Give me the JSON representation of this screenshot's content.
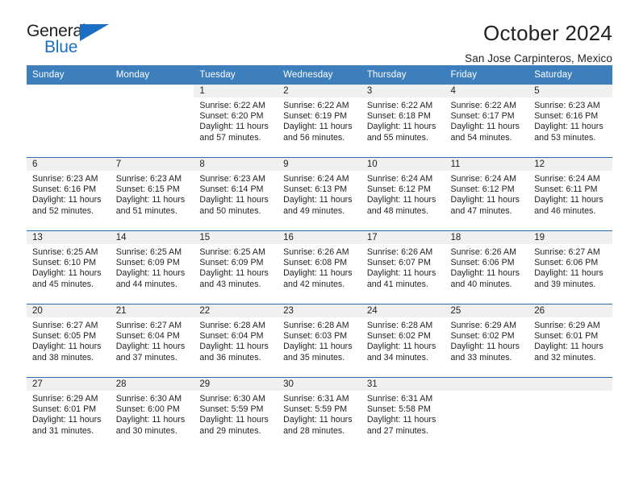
{
  "brand": {
    "name_top": "General",
    "name_bottom": "Blue",
    "triangle_icon": "triangle-icon",
    "color_black": "#231f20",
    "color_blue": "#1a6fc4"
  },
  "header": {
    "title": "October 2024",
    "subtitle": "San Jose Carpinteros, Mexico"
  },
  "theme": {
    "header_row_bg": "#3d7ebd",
    "row_divider": "#2c6bab",
    "daynum_strip_bg": "#f0f0f0",
    "text": "#222222"
  },
  "weekdays": [
    "Sunday",
    "Monday",
    "Tuesday",
    "Wednesday",
    "Thursday",
    "Friday",
    "Saturday"
  ],
  "labels": {
    "sunrise": "Sunrise:",
    "sunset": "Sunset:",
    "daylight": "Daylight:"
  },
  "weeks": [
    [
      {
        "day": "",
        "blank": true
      },
      {
        "day": "",
        "blank": true
      },
      {
        "day": "1",
        "sunrise": "Sunrise: 6:22 AM",
        "sunset": "Sunset: 6:20 PM",
        "daylight": "Daylight: 11 hours and 57 minutes."
      },
      {
        "day": "2",
        "sunrise": "Sunrise: 6:22 AM",
        "sunset": "Sunset: 6:19 PM",
        "daylight": "Daylight: 11 hours and 56 minutes."
      },
      {
        "day": "3",
        "sunrise": "Sunrise: 6:22 AM",
        "sunset": "Sunset: 6:18 PM",
        "daylight": "Daylight: 11 hours and 55 minutes."
      },
      {
        "day": "4",
        "sunrise": "Sunrise: 6:22 AM",
        "sunset": "Sunset: 6:17 PM",
        "daylight": "Daylight: 11 hours and 54 minutes."
      },
      {
        "day": "5",
        "sunrise": "Sunrise: 6:23 AM",
        "sunset": "Sunset: 6:16 PM",
        "daylight": "Daylight: 11 hours and 53 minutes."
      }
    ],
    [
      {
        "day": "6",
        "sunrise": "Sunrise: 6:23 AM",
        "sunset": "Sunset: 6:16 PM",
        "daylight": "Daylight: 11 hours and 52 minutes."
      },
      {
        "day": "7",
        "sunrise": "Sunrise: 6:23 AM",
        "sunset": "Sunset: 6:15 PM",
        "daylight": "Daylight: 11 hours and 51 minutes."
      },
      {
        "day": "8",
        "sunrise": "Sunrise: 6:23 AM",
        "sunset": "Sunset: 6:14 PM",
        "daylight": "Daylight: 11 hours and 50 minutes."
      },
      {
        "day": "9",
        "sunrise": "Sunrise: 6:24 AM",
        "sunset": "Sunset: 6:13 PM",
        "daylight": "Daylight: 11 hours and 49 minutes."
      },
      {
        "day": "10",
        "sunrise": "Sunrise: 6:24 AM",
        "sunset": "Sunset: 6:12 PM",
        "daylight": "Daylight: 11 hours and 48 minutes."
      },
      {
        "day": "11",
        "sunrise": "Sunrise: 6:24 AM",
        "sunset": "Sunset: 6:12 PM",
        "daylight": "Daylight: 11 hours and 47 minutes."
      },
      {
        "day": "12",
        "sunrise": "Sunrise: 6:24 AM",
        "sunset": "Sunset: 6:11 PM",
        "daylight": "Daylight: 11 hours and 46 minutes."
      }
    ],
    [
      {
        "day": "13",
        "sunrise": "Sunrise: 6:25 AM",
        "sunset": "Sunset: 6:10 PM",
        "daylight": "Daylight: 11 hours and 45 minutes."
      },
      {
        "day": "14",
        "sunrise": "Sunrise: 6:25 AM",
        "sunset": "Sunset: 6:09 PM",
        "daylight": "Daylight: 11 hours and 44 minutes."
      },
      {
        "day": "15",
        "sunrise": "Sunrise: 6:25 AM",
        "sunset": "Sunset: 6:09 PM",
        "daylight": "Daylight: 11 hours and 43 minutes."
      },
      {
        "day": "16",
        "sunrise": "Sunrise: 6:26 AM",
        "sunset": "Sunset: 6:08 PM",
        "daylight": "Daylight: 11 hours and 42 minutes."
      },
      {
        "day": "17",
        "sunrise": "Sunrise: 6:26 AM",
        "sunset": "Sunset: 6:07 PM",
        "daylight": "Daylight: 11 hours and 41 minutes."
      },
      {
        "day": "18",
        "sunrise": "Sunrise: 6:26 AM",
        "sunset": "Sunset: 6:06 PM",
        "daylight": "Daylight: 11 hours and 40 minutes."
      },
      {
        "day": "19",
        "sunrise": "Sunrise: 6:27 AM",
        "sunset": "Sunset: 6:06 PM",
        "daylight": "Daylight: 11 hours and 39 minutes."
      }
    ],
    [
      {
        "day": "20",
        "sunrise": "Sunrise: 6:27 AM",
        "sunset": "Sunset: 6:05 PM",
        "daylight": "Daylight: 11 hours and 38 minutes."
      },
      {
        "day": "21",
        "sunrise": "Sunrise: 6:27 AM",
        "sunset": "Sunset: 6:04 PM",
        "daylight": "Daylight: 11 hours and 37 minutes."
      },
      {
        "day": "22",
        "sunrise": "Sunrise: 6:28 AM",
        "sunset": "Sunset: 6:04 PM",
        "daylight": "Daylight: 11 hours and 36 minutes."
      },
      {
        "day": "23",
        "sunrise": "Sunrise: 6:28 AM",
        "sunset": "Sunset: 6:03 PM",
        "daylight": "Daylight: 11 hours and 35 minutes."
      },
      {
        "day": "24",
        "sunrise": "Sunrise: 6:28 AM",
        "sunset": "Sunset: 6:02 PM",
        "daylight": "Daylight: 11 hours and 34 minutes."
      },
      {
        "day": "25",
        "sunrise": "Sunrise: 6:29 AM",
        "sunset": "Sunset: 6:02 PM",
        "daylight": "Daylight: 11 hours and 33 minutes."
      },
      {
        "day": "26",
        "sunrise": "Sunrise: 6:29 AM",
        "sunset": "Sunset: 6:01 PM",
        "daylight": "Daylight: 11 hours and 32 minutes."
      }
    ],
    [
      {
        "day": "27",
        "sunrise": "Sunrise: 6:29 AM",
        "sunset": "Sunset: 6:01 PM",
        "daylight": "Daylight: 11 hours and 31 minutes."
      },
      {
        "day": "28",
        "sunrise": "Sunrise: 6:30 AM",
        "sunset": "Sunset: 6:00 PM",
        "daylight": "Daylight: 11 hours and 30 minutes."
      },
      {
        "day": "29",
        "sunrise": "Sunrise: 6:30 AM",
        "sunset": "Sunset: 5:59 PM",
        "daylight": "Daylight: 11 hours and 29 minutes."
      },
      {
        "day": "30",
        "sunrise": "Sunrise: 6:31 AM",
        "sunset": "Sunset: 5:59 PM",
        "daylight": "Daylight: 11 hours and 28 minutes."
      },
      {
        "day": "31",
        "sunrise": "Sunrise: 6:31 AM",
        "sunset": "Sunset: 5:58 PM",
        "daylight": "Daylight: 11 hours and 27 minutes."
      },
      {
        "day": "",
        "empty": true
      },
      {
        "day": "",
        "empty": true
      }
    ]
  ]
}
